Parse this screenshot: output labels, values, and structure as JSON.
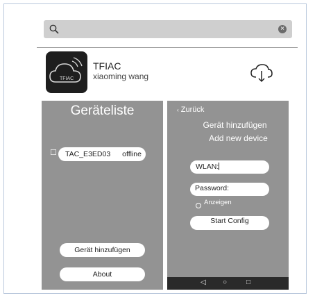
{
  "search": {
    "placeholder": "",
    "clear_glyph": "×"
  },
  "app": {
    "name": "TFIAC",
    "author": "xiaoming wang",
    "icon_text": "TFIAC"
  },
  "left_screen": {
    "title": "Geräteliste",
    "device": {
      "name": "TAC_E3ED03",
      "status": "offline"
    },
    "add_button": "Gerät hinzufügen",
    "about_button": "About"
  },
  "right_screen": {
    "back_label": "Zurück",
    "title_de": "Gerät hinzufügen",
    "title_en": "Add new device",
    "wlan_label": "WLAN:",
    "password_label": "Password:",
    "show_label": "Anzeigen",
    "start_button": "Start Config",
    "nav": {
      "back": "◁",
      "home": "○",
      "recent": "□"
    }
  },
  "colors": {
    "screen_bg": "#939393",
    "search_bg": "#cfcfcf",
    "navbar": "#2a2a2a"
  }
}
